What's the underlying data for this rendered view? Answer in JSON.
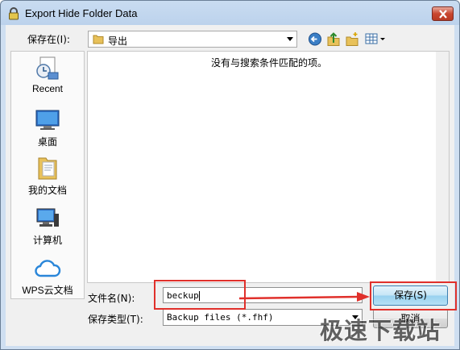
{
  "window": {
    "title": "Export Hide Folder Data"
  },
  "toolbar": {
    "save_in_label": "保存在(I):",
    "location": "导出"
  },
  "places": [
    {
      "label": "Recent",
      "icon": "recent-places-icon"
    },
    {
      "label": "桌面",
      "icon": "desktop-icon"
    },
    {
      "label": "我的文档",
      "icon": "my-documents-icon"
    },
    {
      "label": "计算机",
      "icon": "computer-icon"
    },
    {
      "label": "WPS云文档",
      "icon": "wps-cloud-icon"
    }
  ],
  "file_list": {
    "empty_message": "没有与搜索条件匹配的项。"
  },
  "form": {
    "filename_label": "文件名(N):",
    "filename_value": "beckup",
    "filetype_label": "保存类型(T):",
    "filetype_value": "Backup files (*.fhf)"
  },
  "buttons": {
    "save": "保存(S)",
    "cancel": "取消"
  },
  "watermark": "极速下载站",
  "colors": {
    "highlight": "#e0302b",
    "title_gradient": "#c9dcf1",
    "close_button": "#c9472f"
  }
}
